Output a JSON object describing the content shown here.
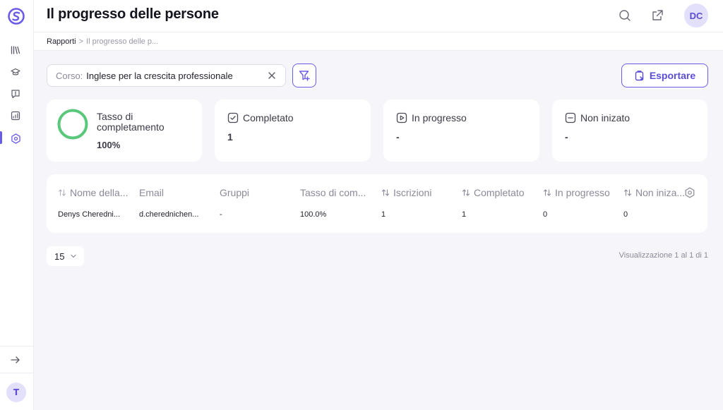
{
  "header": {
    "title": "Il progresso delle persone",
    "user_initials": "DC"
  },
  "breadcrumb": {
    "root": "Rapporti",
    "separator": ">",
    "current": "Il progresso delle p..."
  },
  "sidebar": {
    "items": [
      {
        "icon": "library-icon"
      },
      {
        "icon": "graduation-cap-icon"
      },
      {
        "icon": "feedback-icon"
      },
      {
        "icon": "analytics-icon"
      },
      {
        "icon": "target-icon",
        "active": true
      }
    ],
    "collapse_icon": "arrow-right-icon",
    "user_initial": "T"
  },
  "filter": {
    "label": "Corso:",
    "value": "Inglese per la crescita professionale"
  },
  "export_label": "Esportare",
  "summary": {
    "rate_title": "Tasso di completamento",
    "rate_value": "100%",
    "rate_fraction": 1.0,
    "completed_title": "Completato",
    "completed_value": "1",
    "in_progress_title": "In progresso",
    "in_progress_value": "-",
    "not_started_title": "Non inizato",
    "not_started_value": "-"
  },
  "table": {
    "columns": [
      "Nome della...",
      "Email",
      "Gruppi",
      "Tasso di com...",
      "Iscrizioni",
      "Completato",
      "In progresso",
      "Non iniza..."
    ],
    "rows": [
      [
        "Denys Cheredni...",
        "d.cherednichen...",
        "-",
        "100.0%",
        "1",
        "1",
        "0",
        "0"
      ]
    ]
  },
  "pagination": {
    "page_size": "15",
    "info": "Visualizzazione 1 al 1 di 1"
  },
  "colors": {
    "accent": "#6b5ce7",
    "success": "#5ac87a"
  }
}
